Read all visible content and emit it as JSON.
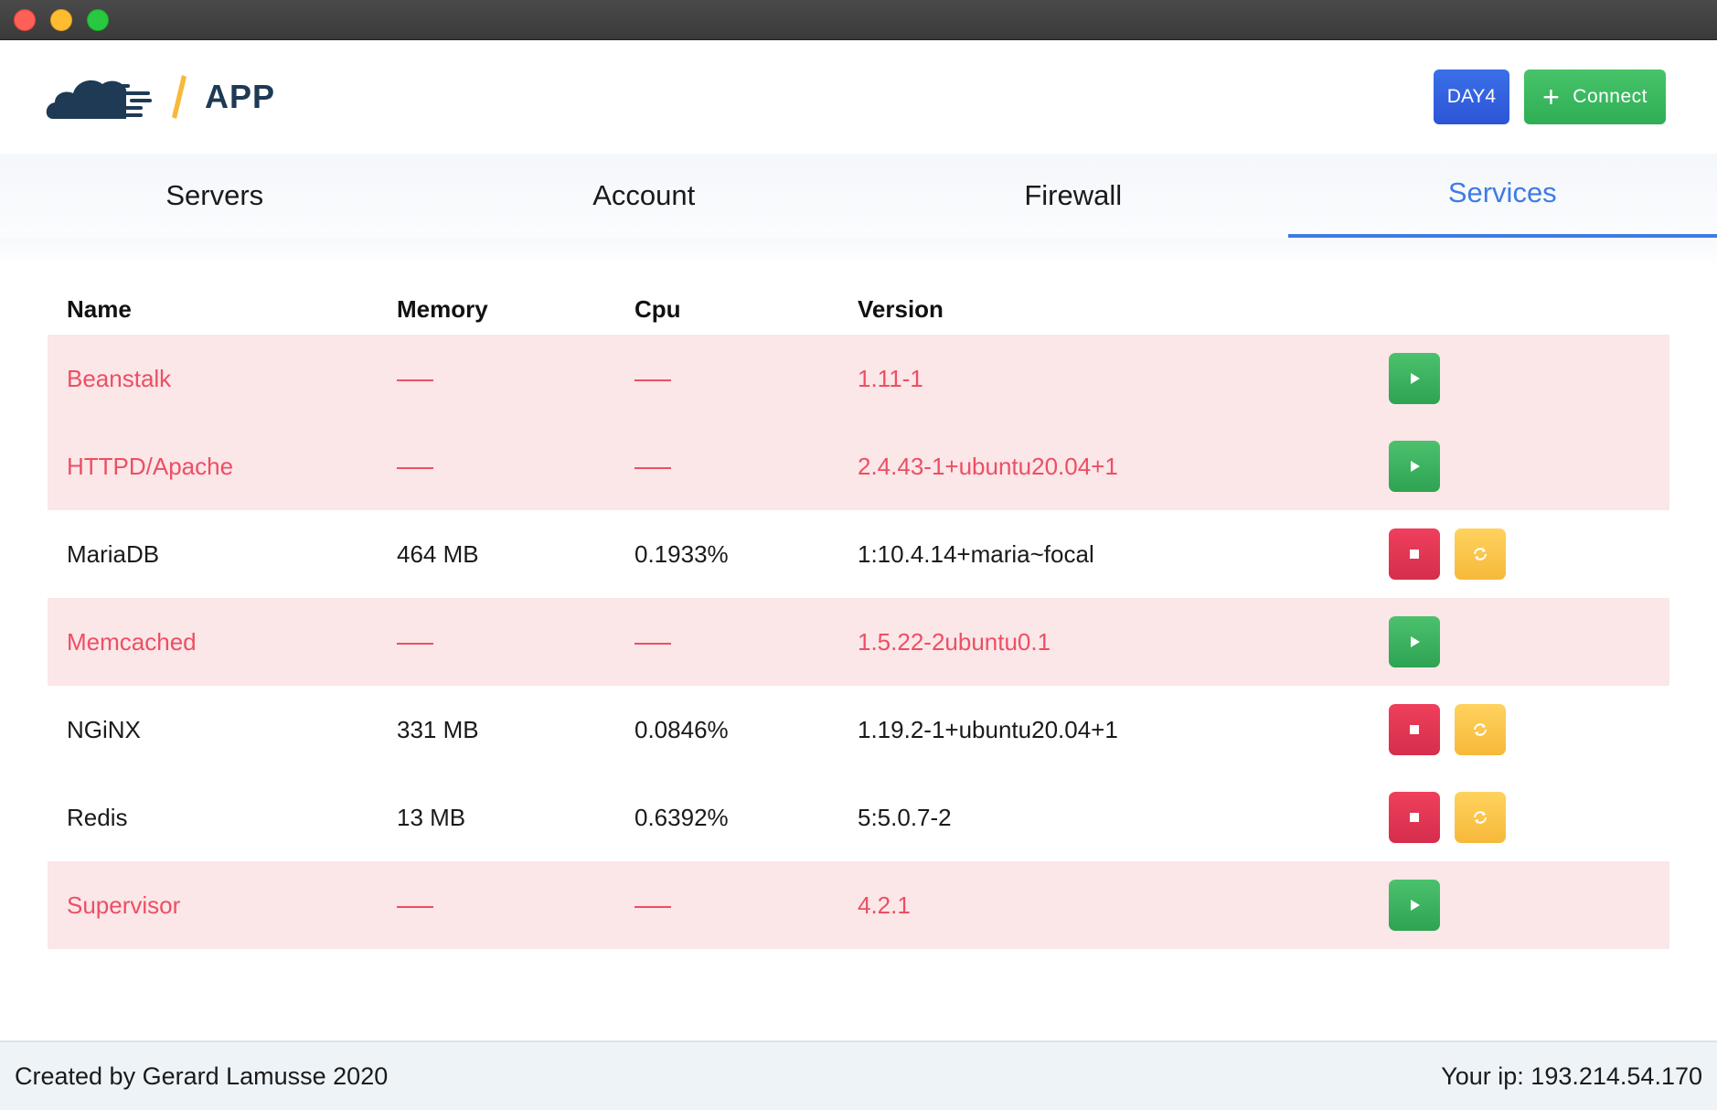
{
  "app": {
    "name": "APP"
  },
  "header": {
    "day_label": "DAY4",
    "connect_label": "Connect"
  },
  "tabs": [
    {
      "label": "Servers",
      "active": false
    },
    {
      "label": "Account",
      "active": false
    },
    {
      "label": "Firewall",
      "active": false
    },
    {
      "label": "Services",
      "active": true
    }
  ],
  "table": {
    "columns": [
      "Name",
      "Memory",
      "Cpu",
      "Version"
    ],
    "rows": [
      {
        "name": "Beanstalk",
        "memory": "",
        "cpu": "",
        "version": "1.11-1",
        "status": "stopped"
      },
      {
        "name": "HTTPD/Apache",
        "memory": "",
        "cpu": "",
        "version": "2.4.43-1+ubuntu20.04+1",
        "status": "stopped"
      },
      {
        "name": "MariaDB",
        "memory": "464 MB",
        "cpu": "0.1933%",
        "version": "1:10.4.14+maria~focal",
        "status": "running"
      },
      {
        "name": "Memcached",
        "memory": "",
        "cpu": "",
        "version": "1.5.22-2ubuntu0.1",
        "status": "stopped"
      },
      {
        "name": "NGiNX",
        "memory": "331 MB",
        "cpu": "0.0846%",
        "version": "1.19.2-1+ubuntu20.04+1",
        "status": "running"
      },
      {
        "name": "Redis",
        "memory": "13 MB",
        "cpu": "0.6392%",
        "version": "5:5.0.7-2",
        "status": "running"
      },
      {
        "name": "Supervisor",
        "memory": "",
        "cpu": "",
        "version": "4.2.1",
        "status": "stopped"
      }
    ]
  },
  "footer": {
    "credit": "Created by Gerard Lamusse 2020",
    "ip": "Your ip: 193.214.54.170"
  },
  "colors": {
    "accent": "#3f7be6",
    "stopped_row_bg": "#fbe6e8",
    "stopped_text": "#ec4f63",
    "start_button": "#2ea352",
    "stop_button": "#d52e4c",
    "restart_button": "#f6b93a",
    "logo_navy": "#1e3a55",
    "logo_slash": "#f6b93a"
  },
  "icons": {
    "start": "play-icon",
    "stop": "stop-icon",
    "restart": "restart-icon",
    "connect": "plus-icon"
  }
}
